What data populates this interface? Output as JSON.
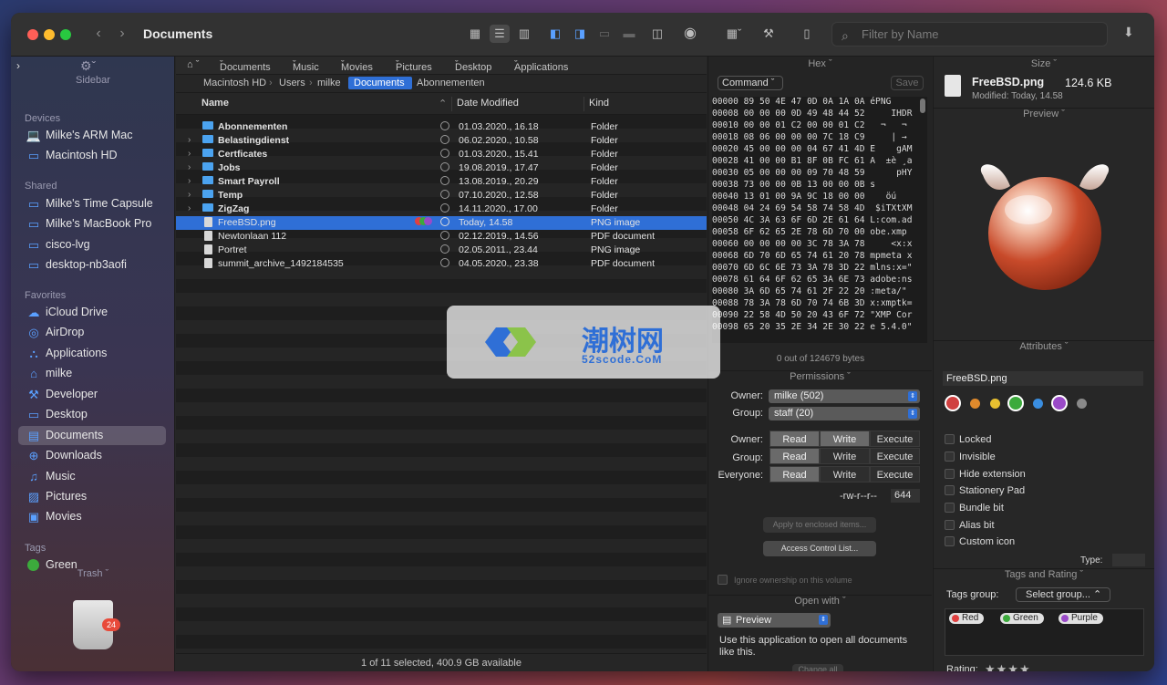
{
  "window": {
    "title": "Documents",
    "filter_placeholder": "Filter by Name"
  },
  "sidebar": {
    "toggle_label": "Sidebar",
    "sections": [
      {
        "header": "Devices",
        "items": [
          {
            "label": "Milke's ARM Mac",
            "icon": "laptop-icon"
          },
          {
            "label": "Macintosh HD",
            "icon": "harddisk-icon"
          }
        ]
      },
      {
        "header": "Shared",
        "items": [
          {
            "label": "Milke's Time Capsule",
            "icon": "display-icon"
          },
          {
            "label": "Milke's MacBook Pro",
            "icon": "display-icon"
          },
          {
            "label": "cisco-lvg",
            "icon": "display-icon"
          },
          {
            "label": "desktop-nb3aofi",
            "icon": "display-icon"
          }
        ]
      },
      {
        "header": "Favorites",
        "items": [
          {
            "label": "iCloud Drive",
            "icon": "cloud-icon"
          },
          {
            "label": "AirDrop",
            "icon": "airdrop-icon"
          },
          {
            "label": "Applications",
            "icon": "applications-icon"
          },
          {
            "label": "milke",
            "icon": "home-icon"
          },
          {
            "label": "Developer",
            "icon": "hammer-icon"
          },
          {
            "label": "Desktop",
            "icon": "desktop-icon"
          },
          {
            "label": "Documents",
            "icon": "document-folder-icon",
            "selected": true
          },
          {
            "label": "Downloads",
            "icon": "download-icon"
          },
          {
            "label": "Music",
            "icon": "music-icon"
          },
          {
            "label": "Pictures",
            "icon": "pictures-icon"
          },
          {
            "label": "Movies",
            "icon": "movies-icon"
          }
        ]
      },
      {
        "header": "Tags",
        "items": [
          {
            "label": "Green",
            "icon": "tag-dot",
            "color": "#3caa3c"
          }
        ]
      }
    ],
    "trash_label": "Trash",
    "trash_badge": "24"
  },
  "pathbar": {
    "items": [
      "Documents",
      "Music",
      "Movies",
      "Pictures",
      "Desktop",
      "Applications"
    ]
  },
  "breadcrumb": {
    "items": [
      "Macintosh HD",
      "Users",
      "milke",
      "Documents",
      "Abonnementen"
    ],
    "selected": "Documents"
  },
  "columns": {
    "name": "Name",
    "date": "Date Modified",
    "kind": "Kind"
  },
  "files": [
    {
      "name": "Abonnementen",
      "date": "01.03.2020., 16.18",
      "kind": "Folder",
      "folder": true,
      "expandable": false
    },
    {
      "name": "Belastingdienst",
      "date": "06.02.2020., 10.58",
      "kind": "Folder",
      "folder": true,
      "expandable": true
    },
    {
      "name": "Certficates",
      "date": "01.03.2020., 15.41",
      "kind": "Folder",
      "folder": true,
      "expandable": true
    },
    {
      "name": "Jobs",
      "date": "19.08.2019., 17.47",
      "kind": "Folder",
      "folder": true,
      "expandable": true
    },
    {
      "name": "Smart Payroll",
      "date": "13.08.2019., 20.29",
      "kind": "Folder",
      "folder": true,
      "expandable": true
    },
    {
      "name": "Temp",
      "date": "07.10.2020., 12.58",
      "kind": "Folder",
      "folder": true,
      "expandable": true
    },
    {
      "name": "ZigZag",
      "date": "14.11.2020., 17.00",
      "kind": "Folder",
      "folder": true,
      "expandable": true
    },
    {
      "name": "FreeBSD.png",
      "date": "Today, 14.58",
      "kind": "PNG image",
      "folder": false,
      "selected": true
    },
    {
      "name": "Newtonlaan 112",
      "date": "02.12.2019., 14.56",
      "kind": "PDF document",
      "folder": false
    },
    {
      "name": "Portret",
      "date": "02.05.2011., 23.44",
      "kind": "PNG image",
      "folder": false
    },
    {
      "name": "summit_archive_1492184535",
      "date": "04.05.2020., 23.38",
      "kind": "PDF document",
      "folder": false
    }
  ],
  "status": "1 of 11 selected, 400.9 GB available",
  "hex": {
    "header": "Hex",
    "mode": "Command",
    "save_label": "Save",
    "lines": [
      "00000 89 50 4E 47 0D 0A 1A 0A éPNG",
      "00008 00 00 00 0D 49 48 44 52     IHDR",
      "00010 00 00 01 C2 00 00 01 C2   ¬   ¬",
      "00018 08 06 00 00 00 7C 18 C9     | →",
      "00020 45 00 00 00 04 67 41 4D E    gAM",
      "00028 41 00 00 B1 8F 0B FC 61 A  ±è ¸a",
      "00030 05 00 00 00 09 70 48 59      pHY",
      "00038 73 00 00 0B 13 00 00 0B s",
      "00040 13 01 00 9A 9C 18 00 00    öú",
      "00048 04 24 69 54 58 74 58 4D  $iTXtXM",
      "00050 4C 3A 63 6F 6D 2E 61 64 L:com.ad",
      "00058 6F 62 65 2E 78 6D 70 00 obe.xmp",
      "00060 00 00 00 00 3C 78 3A 78     <x:x",
      "00068 6D 70 6D 65 74 61 20 78 mpmeta x",
      "00070 6D 6C 6E 73 3A 78 3D 22 mlns:x=\"",
      "00078 61 64 6F 62 65 3A 6E 73 adobe:ns",
      "00080 3A 6D 65 74 61 2F 22 20 :meta/\"",
      "00088 78 3A 78 6D 70 74 6B 3D x:xmptk=",
      "00090 22 58 4D 50 20 43 6F 72 \"XMP Cor",
      "00098 65 20 35 2E 34 2E 30 22 e 5.4.0\""
    ],
    "count": "0 out of 124679 bytes"
  },
  "permissions": {
    "header": "Permissions",
    "owner_label": "Owner:",
    "owner_value": "milke (502)",
    "group_label": "Group:",
    "group_value": "staff (20)",
    "matrix_labels": [
      "Owner:",
      "Group:",
      "Everyone:"
    ],
    "matrix_cols": [
      "Read",
      "Write",
      "Execute"
    ],
    "octal_text": "-rw-r--r--",
    "octal": "644",
    "apply_label": "Apply to enclosed items...",
    "acl_label": "Access Control List...",
    "ignore_label": "Ignore ownership on this volume"
  },
  "open_with": {
    "header": "Open with",
    "app": "Preview",
    "description": "Use this application to open all documents like this.",
    "change_all": "Change all"
  },
  "info": {
    "size_header": "Size",
    "name": "FreeBSD.png",
    "size": "124.6 KB",
    "modified": "Modified: Today, 14.58",
    "preview_header": "Preview",
    "attributes_header": "Attributes",
    "attr_name": "FreeBSD.png",
    "colors": [
      "#d04040",
      "#e08a2c",
      "#e8c030",
      "#3caa3c",
      "#3a8ee0",
      "#9a4ac8",
      "#8a8a8a"
    ],
    "checkboxes": [
      "Locked",
      "Invisible",
      "Hide extension",
      "Stationery Pad",
      "Bundle bit",
      "Alias bit",
      "Custom icon"
    ],
    "type_label": "Type:",
    "tags_header": "Tags and Rating",
    "tags_group_label": "Tags group:",
    "tags_group_value": "Select group...",
    "tags": [
      {
        "label": "Red",
        "color": "#e04040"
      },
      {
        "label": "Green",
        "color": "#3caa3c"
      },
      {
        "label": "Purple",
        "color": "#9a4ac8"
      }
    ],
    "rating_label": "Rating:",
    "rating_stars": "★★★★"
  },
  "watermark": {
    "text": "潮树网",
    "sub": "52scode.CoM"
  }
}
